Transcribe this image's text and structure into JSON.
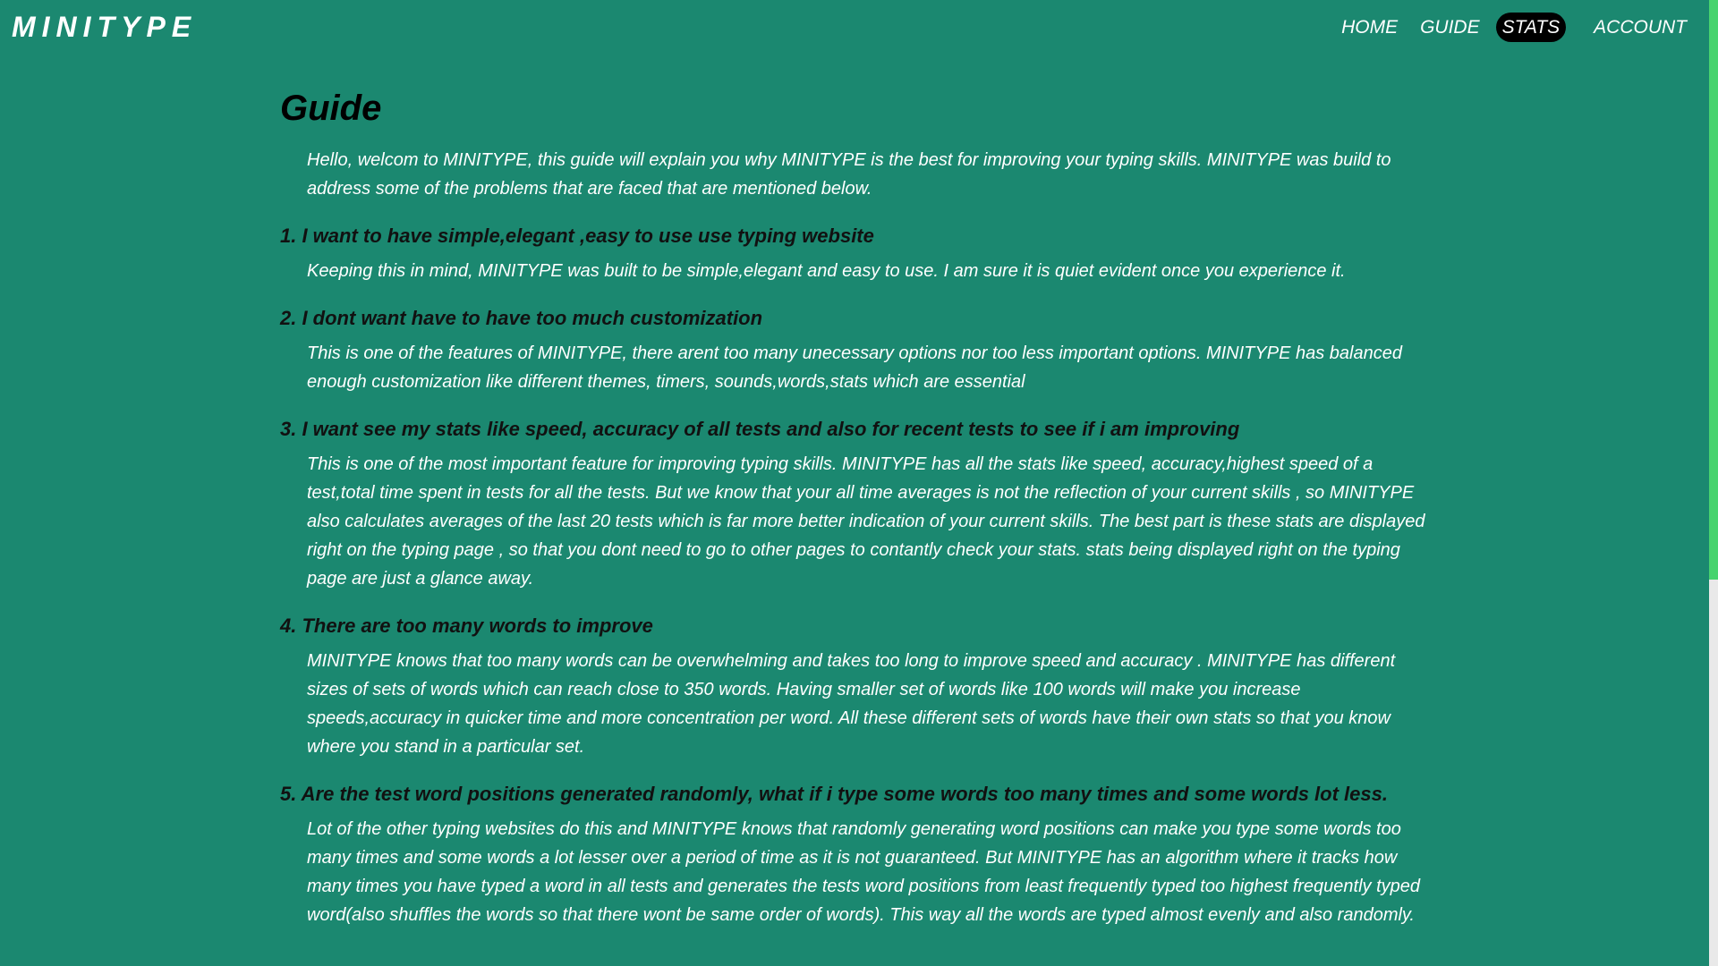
{
  "header": {
    "logo": "MINITYPE",
    "nav": [
      {
        "label": "HOME",
        "active": false
      },
      {
        "label": "GUIDE",
        "active": false
      },
      {
        "label": "STATS",
        "active": true
      },
      {
        "label": "ACCOUNT",
        "active": false
      }
    ]
  },
  "guide": {
    "title": "Guide",
    "intro": "Hello, welcom to MINITYPE, this guide will explain you why MINITYPE is the best for improving your typing skills. MINITYPE was build to address some of the problems that are faced that are mentioned below.",
    "sections": [
      {
        "question": "1. I want to have simple,elegant ,easy to use use typing website",
        "answer": "Keeping this in mind, MINITYPE was built to be simple,elegant and easy to use. I am sure it is quiet evident once you experience it."
      },
      {
        "question": "2. I dont want have to have too much customization",
        "answer": "This is one of the features of MINITYPE, there arent too many unecessary options nor too less important options. MINITYPE has balanced enough customization like different themes, timers, sounds,words,stats which are essential"
      },
      {
        "question": "3. I want see my stats like speed, accuracy of all tests and also for recent tests to see if i am improving",
        "answer": "This is one of the most important feature for improving typing skills. MINITYPE has all the stats like speed, accuracy,highest speed of a test,total time spent in tests for all the tests. But we know that your all time averages is not the reflection of your current skills , so MINITYPE also calculates averages of the last 20 tests which is far more better indication of your current skills. The best part is these stats are displayed right on the typing page , so that you dont need to go to other pages to contantly check your stats. stats being displayed right on the typing page are just a glance away."
      },
      {
        "question": "4. There are too many words to improve",
        "answer": "MINITYPE knows that too many words can be overwhelming and takes too long to improve speed and accuracy . MINITYPE has different sizes of sets of words which can reach close to 350 words. Having smaller set of words like 100 words will make you increase speeds,accuracy in quicker time and more concentration per word. All these different sets of words have their own stats so that you know where you stand in a particular set."
      },
      {
        "question": "5. Are the test word positions generated randomly, what if i type some words too many times and some words lot less.",
        "answer": "Lot of the other typing websites do this and MINITYPE knows that randomly generating word positions can make you type some words too many times and some words a lot lesser over a period of time as it is not guaranteed. But MINITYPE has an algorithm where it tracks how many times you have typed a word in all tests and generates the tests word positions from least frequently typed too highest frequently typed word(also shuffles the words so that there wont be same order of words). This way all the words are typed almost evenly and also randomly."
      }
    ]
  },
  "colors": {
    "background": "#1b8870",
    "active_nav": "#000000",
    "scroll_thumb": "#47d36e"
  }
}
